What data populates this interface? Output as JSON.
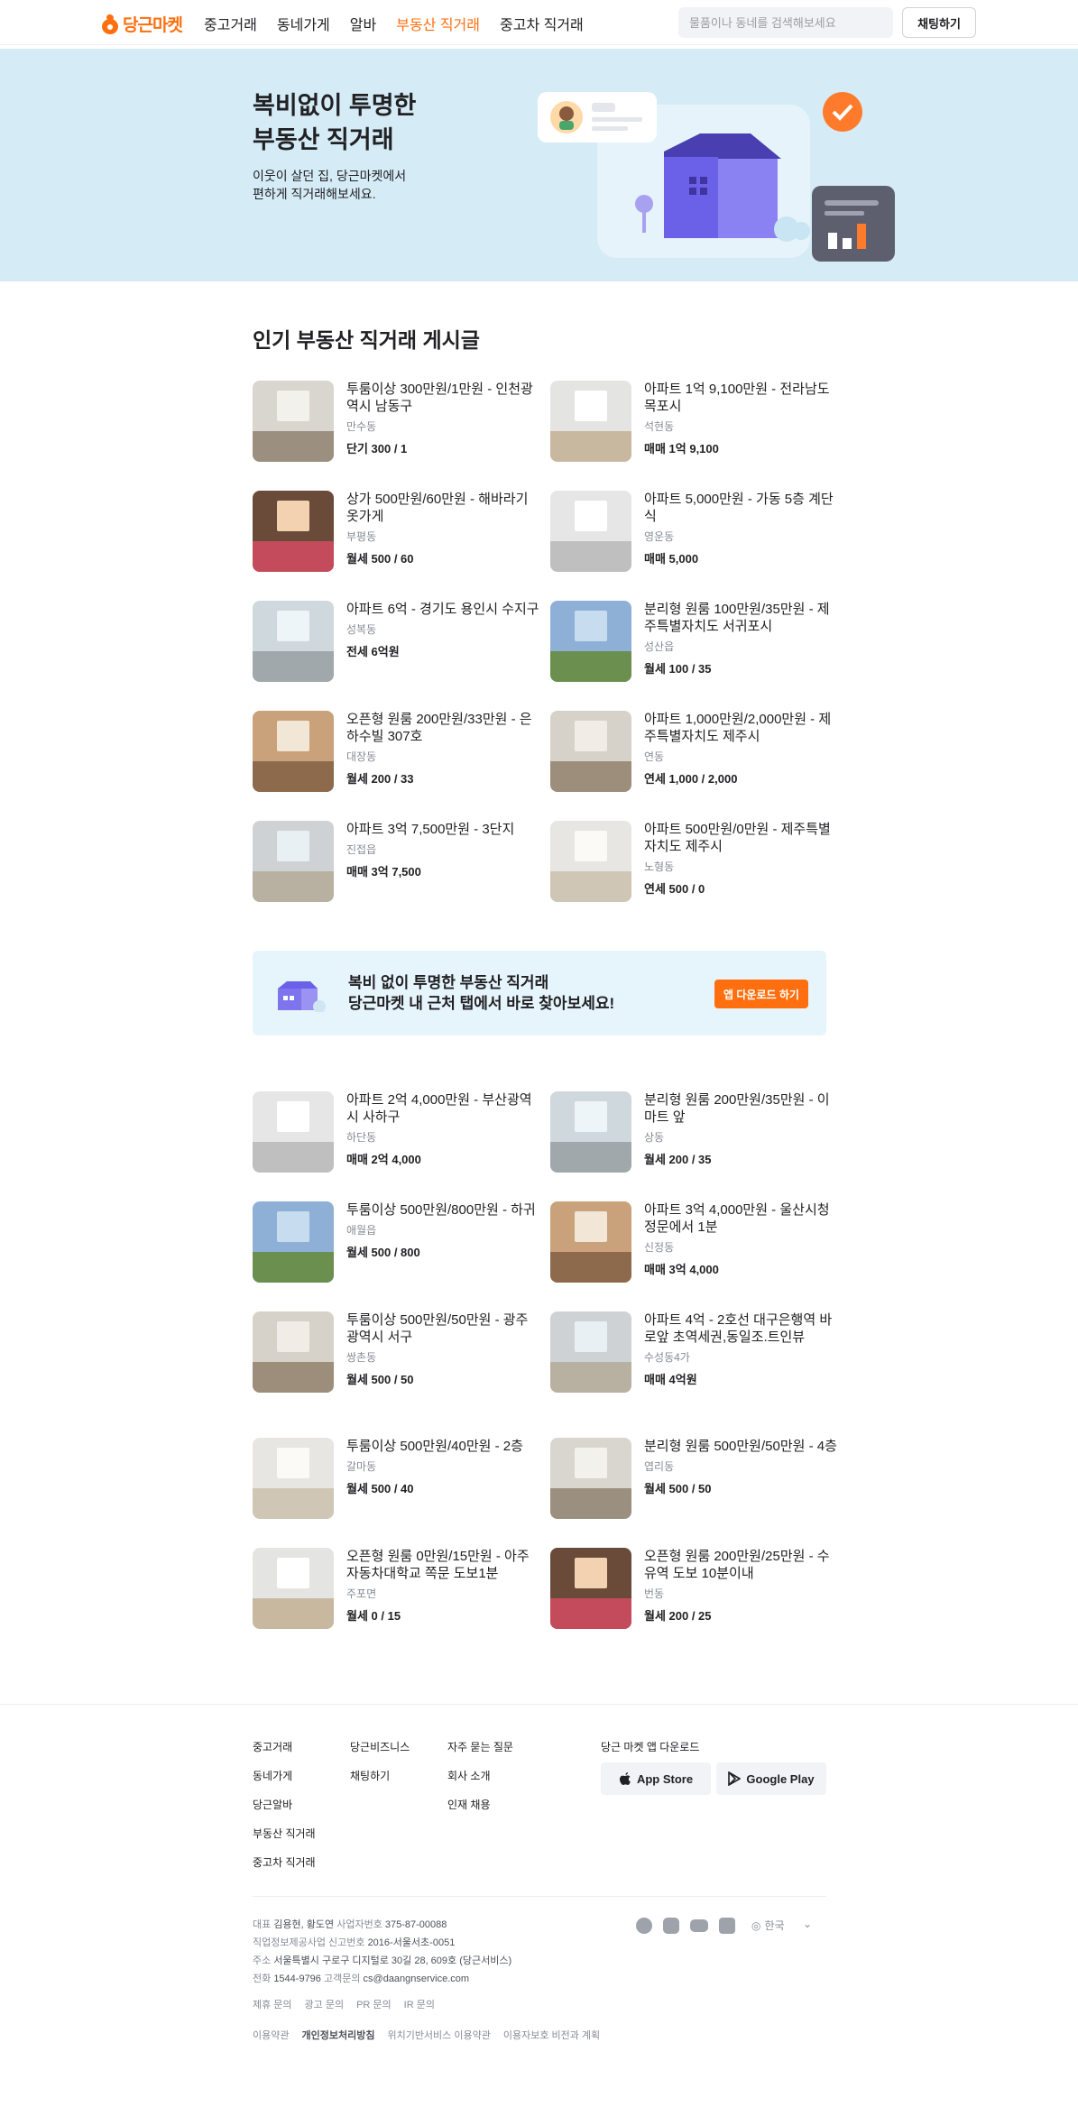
{
  "header": {
    "logo": "당근마켓",
    "nav": [
      "중고거래",
      "동네가게",
      "알바",
      "부동산 직거래",
      "중고차 직거래"
    ],
    "active_nav": "부동산 직거래",
    "search_placeholder": "물품이나 동네를 검색해보세요",
    "chat_button": "채팅하기"
  },
  "hero": {
    "title": "복비없이 투명한\n부동산 직거래",
    "description": "이웃이 살던 집, 당근마켓에서\n편하게 직거래해보세요."
  },
  "listings_title": "인기 부동산 직거래 게시글",
  "listings_top": [
    {
      "title": "투룸이상 300만원/1만원 - 인천광역시 남동구",
      "region": "만수동",
      "price": "단기 300 / 1"
    },
    {
      "title": "아파트 1억 9,100만원 - 전라남도 목포시",
      "region": "석현동",
      "price": "매매 1억 9,100"
    },
    {
      "title": "상가 500만원/60만원 - 해바라기 옷가게",
      "region": "부평동",
      "price": "월세 500 / 60"
    },
    {
      "title": "아파트 5,000만원 - 가동 5층 계단식",
      "region": "영운동",
      "price": "매매 5,000"
    },
    {
      "title": "아파트 6억 - 경기도 용인시 수지구",
      "region": "성복동",
      "price": "전세 6억원"
    },
    {
      "title": "분리형 원룸 100만원/35만원 - 제주특별자치도 서귀포시",
      "region": "성산읍",
      "price": "월세 100 / 35"
    },
    {
      "title": "오픈형 원룸 200만원/33만원 - 은하수빌 307호",
      "region": "대장동",
      "price": "월세 200 / 33"
    },
    {
      "title": "아파트 1,000만원/2,000만원 - 제주특별자치도 제주시",
      "region": "연동",
      "price": "연세 1,000 / 2,000"
    },
    {
      "title": "아파트 3억 7,500만원 - 3단지",
      "region": "진접읍",
      "price": "매매 3억 7,500"
    },
    {
      "title": "아파트 500만원/0만원 - 제주특별자치도 제주시",
      "region": "노형동",
      "price": "연세 500 / 0"
    }
  ],
  "banner": {
    "line1": "복비 없이 투명한 부동산 직거래",
    "line2": "당근마켓 내 근처 탭에서 바로 찾아보세요!",
    "button": "앱 다운로드 하기"
  },
  "listings_bottom": [
    {
      "title": "아파트 2억 4,000만원 - 부산광역시 사하구",
      "region": "하단동",
      "price": "매매 2억 4,000"
    },
    {
      "title": "분리형 원룸 200만원/35만원 - 이마트 앞",
      "region": "상동",
      "price": "월세 200 / 35"
    },
    {
      "title": "투룸이상 500만원/800만원 - 하귀",
      "region": "애월읍",
      "price": "월세 500 / 800"
    },
    {
      "title": "아파트 3억 4,000만원 - 울산시청 정문에서 1분",
      "region": "신정동",
      "price": "매매 3억 4,000"
    },
    {
      "title": "투룸이상 500만원/50만원 - 광주광역시 서구",
      "region": "쌍촌동",
      "price": "월세 500 / 50"
    },
    {
      "title": "아파트 4억 - 2호선 대구은행역 바로앞 초역세권,동일조.트인뷰",
      "region": "수성동4가",
      "price": "매매 4억원"
    },
    {
      "title": "투룸이상 500만원/40만원 - 2층",
      "region": "갈마동",
      "price": "월세 500 / 40"
    },
    {
      "title": "분리형 원룸 500만원/50만원 - 4층",
      "region": "엽리동",
      "price": "월세 500 / 50"
    },
    {
      "title": "오픈형 원룸 0만원/15만원 - 아주자동차대학교 쪽문 도보1분",
      "region": "주포면",
      "price": "월세 0 / 15"
    },
    {
      "title": "오픈형 원룸 200만원/25만원 - 수유역 도보 10분이내",
      "region": "번동",
      "price": "월세 200 / 25"
    }
  ],
  "footer": {
    "col1": [
      "중고거래",
      "동네가게",
      "당근알바",
      "부동산 직거래",
      "중고차 직거래"
    ],
    "col2": [
      "당근비즈니스",
      "채팅하기"
    ],
    "col3": [
      "자주 묻는 질문",
      "회사 소개",
      "인재 채용"
    ],
    "download_title": "당근 마켓 앱 다운로드",
    "app_store": "App Store",
    "google_play": "Google Play",
    "info": [
      {
        "label": "대표",
        "value": "김용현, 황도연"
      },
      {
        "label": "사업자번호",
        "value": "375-87-00088"
      },
      {
        "label": "직업정보제공사업 신고번호",
        "value": "2016-서울서초-0051"
      },
      {
        "label": "주소",
        "value": "서울특별시 구로구 디지털로 30길 28, 609호 (당근서비스)"
      },
      {
        "label": "전화",
        "value": "1544-9796"
      },
      {
        "label": "고객문의",
        "value": "cs@daangnservice.com"
      }
    ],
    "inquiries": [
      "제휴 문의",
      "광고 문의",
      "PR 문의",
      "IR 문의"
    ],
    "terms": [
      "이용약관",
      "개인정보처리방침",
      "위치기반서비스 이용약관",
      "이용자보호 비전과 계획"
    ],
    "language": "한국"
  },
  "colors": {
    "brand": "#ff6f0f",
    "hero_bg": "#d5ecf7",
    "banner_bg": "#e6f4fb"
  }
}
